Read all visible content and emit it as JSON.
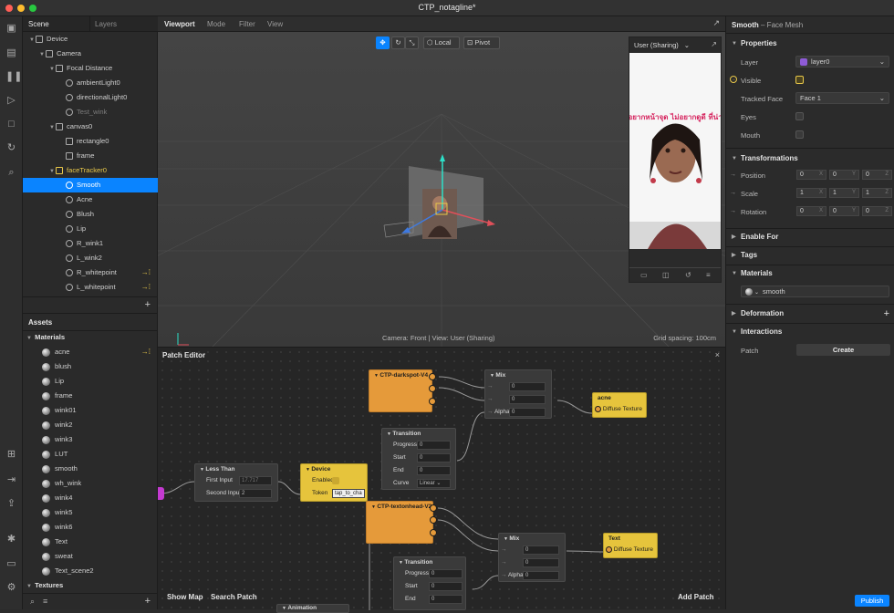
{
  "window": {
    "title": "CTP_notagline*"
  },
  "scene": {
    "tabs": [
      "Scene",
      "Layers"
    ],
    "tree": [
      {
        "label": "Device",
        "indent": 0,
        "icon": "device-icon"
      },
      {
        "label": "Camera",
        "indent": 1,
        "icon": "camera-icon"
      },
      {
        "label": "Focal Distance",
        "indent": 2,
        "icon": "focal-distance-icon"
      },
      {
        "label": "ambientLight0",
        "indent": 3,
        "icon": "light-icon"
      },
      {
        "label": "directionalLight0",
        "indent": 3,
        "icon": "light-icon"
      },
      {
        "label": "Test_wink",
        "indent": 3,
        "icon": "face-icon"
      },
      {
        "label": "canvas0",
        "indent": 2,
        "icon": "canvas-icon"
      },
      {
        "label": "rectangle0",
        "indent": 3,
        "icon": "rectangle-icon"
      },
      {
        "label": "frame",
        "indent": 3,
        "icon": "rectangle-icon"
      },
      {
        "label": "faceTracker0",
        "indent": 2,
        "icon": "face-tracker-icon"
      },
      {
        "label": "Smooth",
        "indent": 3,
        "icon": "face-mesh-icon"
      },
      {
        "label": "Acne",
        "indent": 3,
        "icon": "face-mesh-icon"
      },
      {
        "label": "Blush",
        "indent": 3,
        "icon": "face-mesh-icon"
      },
      {
        "label": "Lip",
        "indent": 3,
        "icon": "face-mesh-icon"
      },
      {
        "label": "R_wink1",
        "indent": 3,
        "icon": "face-icon"
      },
      {
        "label": "L_wink2",
        "indent": 3,
        "icon": "face-icon"
      },
      {
        "label": "R_whitepoint",
        "indent": 3,
        "icon": "face-icon"
      },
      {
        "label": "L_whitepoint",
        "indent": 3,
        "icon": "face-icon"
      }
    ],
    "add": "+"
  },
  "assets": {
    "title": "Assets",
    "materials_header": "Materials",
    "materials": [
      "acne",
      "blush",
      "Lip",
      "frame",
      "wink01",
      "wink2",
      "wink3",
      "LUT",
      "smooth",
      "wh_wink",
      "wink4",
      "wink5",
      "wink6",
      "Text",
      "sweat",
      "Text_scene2"
    ],
    "textures_header": "Textures",
    "add": "+"
  },
  "viewport": {
    "tabs": [
      "Viewport",
      "Mode",
      "Filter",
      "View"
    ],
    "local": "Local",
    "pivot": "Pivot",
    "camera_status": "Camera: Front | View: User (Sharing)",
    "grid_spacing": "Grid spacing: 100cm",
    "preview_title": "User (Sharing)",
    "preview_overlay_text": "ไม่อยากหน้าจุด ไม่อยากดูดี ที่น่ารัก"
  },
  "patch_editor": {
    "title": "Patch Editor",
    "show_map": "Show Map",
    "search_patch": "Search Patch",
    "add_patch": "Add Patch",
    "nodes": {
      "darkspot": "CTP-darkspot-V4",
      "mix1": "Mix",
      "mix1_v1": "0",
      "mix1_v2": "0",
      "mix1_alpha_label": "Alpha",
      "mix1_alpha": "0",
      "acne": "acne",
      "diffuse1": "Diffuse Texture",
      "transition1": "Transition",
      "progress_label": "Progress",
      "start_label": "Start",
      "end_label": "End",
      "curve_label": "Curve",
      "t1_progress": "0",
      "t1_start": "0",
      "t1_end": "0",
      "t1_curve": "Linear",
      "less_than": "Less Than",
      "first_input_label": "First Input",
      "first_input": "17.717",
      "second_input_label": "Second Input",
      "second_input": "2",
      "device": "Device",
      "enabled_label": "Enabled",
      "token_label": "Token",
      "token_value": "tap_to_cha",
      "textonhead": "CTP-textonhead-V2",
      "mix2": "Mix",
      "mix2_v1": "0",
      "mix2_v2": "0",
      "mix2_alpha_label": "Alpha",
      "mix2_alpha": "0",
      "text_node": "Text",
      "diffuse2": "Diffuse Texture",
      "transition2": "Transition",
      "t2_progress": "0",
      "t2_start": "0",
      "t2_end": "0",
      "animation": "Animation"
    }
  },
  "inspector": {
    "header_name": "Smooth",
    "header_type": " – Face Mesh",
    "properties": "Properties",
    "layer_label": "Layer",
    "layer_value": "layer0",
    "layer_color": "#8e5bd6",
    "visible_label": "Visible",
    "tracked_face_label": "Tracked Face",
    "tracked_face_value": "Face 1",
    "eyes_label": "Eyes",
    "mouth_label": "Mouth",
    "transformations": "Transformations",
    "position_label": "Position",
    "scale_label": "Scale",
    "rotation_label": "Rotation",
    "position": [
      "0",
      "0",
      "0"
    ],
    "scale": [
      "1",
      "1",
      "1"
    ],
    "rotation": [
      "0",
      "0",
      "0"
    ],
    "axes": [
      "X",
      "Y",
      "Z"
    ],
    "enable_for": "Enable For",
    "tags": "Tags",
    "materials": "Materials",
    "material_value": "smooth",
    "deformation": "Deformation",
    "interactions": "Interactions",
    "patch_label": "Patch",
    "create": "Create",
    "publish": "Publish",
    "accent": "#0a84ff"
  }
}
